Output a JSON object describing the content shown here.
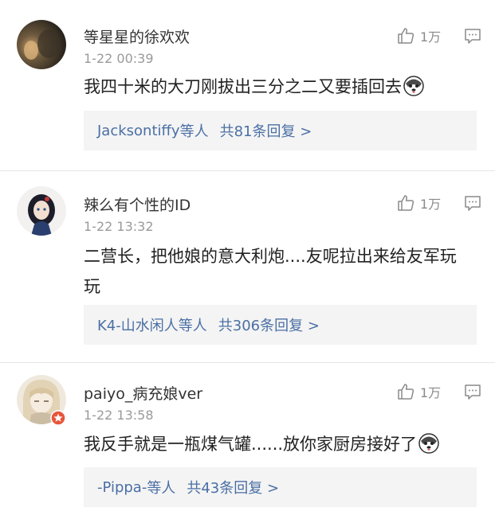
{
  "comments": [
    {
      "username": "等星星的徐欢欢",
      "timestamp": "1-22 00:39",
      "likes": "1万",
      "text": "我四十米的大刀刚拔出三分之二又要插回去",
      "emoji": "husky-emoji",
      "reply_from": "Jacksontiffy",
      "reply_suffix": "等人",
      "reply_count": "共81条回复 >"
    },
    {
      "username": "辣么有个性的ID",
      "timestamp": "1-22 13:32",
      "likes": "1万",
      "text": "二营长，把他娘的意大利炮....友呢拉出来给友军玩玩",
      "reply_from": "K4-山水闲人",
      "reply_suffix": "等人",
      "reply_count": "共306条回复 >"
    },
    {
      "username": "paiyo_病充娘ver",
      "timestamp": "1-22 13:58",
      "likes": "1万",
      "text": "我反手就是一瓶煤气罐......放你家厨房接好了",
      "emoji": "husky-emoji",
      "reply_from": "-Pippa-",
      "reply_suffix": "等人",
      "reply_count": "共43条回复 >"
    }
  ],
  "colors": {
    "link": "#4a6fa5",
    "meta": "#9a9a9a",
    "reply_bg": "#f4f4f4",
    "badge": "#e8553b"
  }
}
